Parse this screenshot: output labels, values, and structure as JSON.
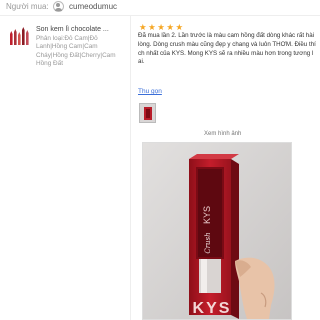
{
  "buyer": {
    "label": "Người mua:",
    "name": "cumeodumuc",
    "avatar_icon": "user-avatar-icon"
  },
  "product": {
    "name": "Son kem lì chocolate ...",
    "variation": "Phân loại:Đỏ Cam|Đỏ Lanh|Hồng Cam|Cam Cháy|Hồng Đất|Cherry|Cam Hồng Đất"
  },
  "review": {
    "rating": 5,
    "stars": "★★★★★",
    "text": "Đã mua lần 2. Lần trước là màu cam hồng đất dòng khác rất hài lòng. Dòng crush màu cũng đẹp y chang và luôn THƠM. Điều thích nhất của KYS. Mong KYS sẽ ra nhiều màu hơn trong tương lai.",
    "collapse_label": "Thu gọn",
    "view_image_label": "Xem hình ảnh",
    "photo_text_brand": "KYS",
    "photo_text_script": "Crush"
  },
  "colors": {
    "star": "#f5a623",
    "link": "#3a6ed8",
    "box_red": "#c0202e"
  }
}
